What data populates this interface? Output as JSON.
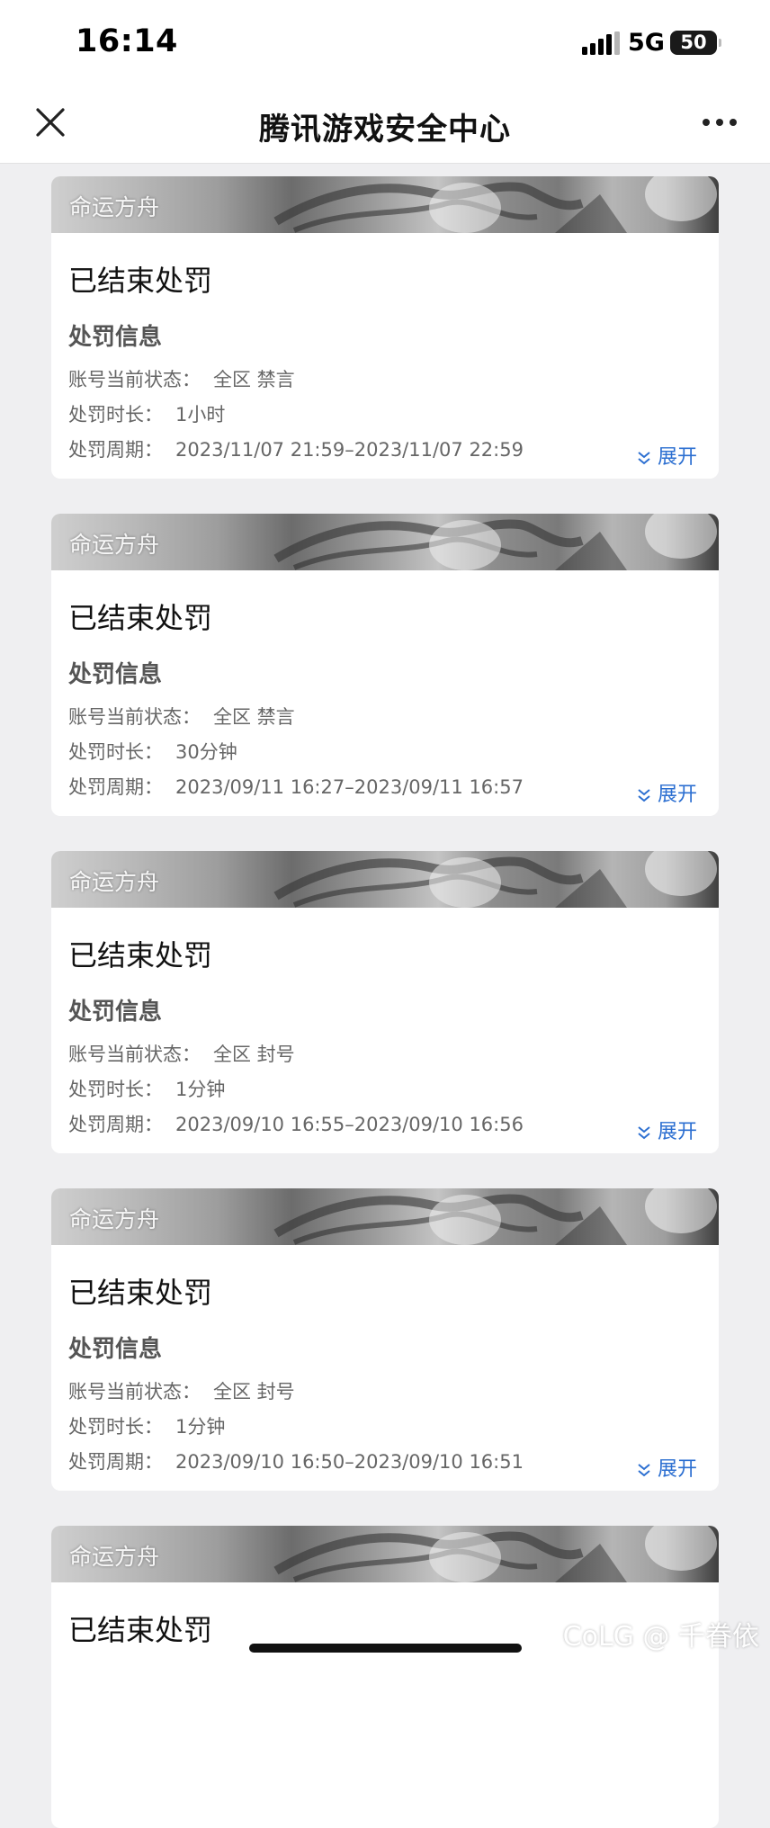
{
  "status_bar": {
    "time": "16:14",
    "network": "5G",
    "battery": "50",
    "signal_icon": "signal-bars-icon",
    "battery_icon": "battery-icon"
  },
  "nav": {
    "title": "腾讯游戏安全中心",
    "close_icon": "close-icon",
    "more_icon": "more-dots-icon"
  },
  "labels": {
    "section_title": "处罚信息",
    "account_status": "账号当前状态：",
    "duration": "处罚时长：",
    "period": "处罚周期：",
    "expand": "展开"
  },
  "cards": [
    {
      "game": "命运方舟",
      "status": "已结束处罚",
      "account_status": "全区 禁言",
      "duration": "1小时",
      "period": "2023/11/07 21:59–2023/11/07 22:59"
    },
    {
      "game": "命运方舟",
      "status": "已结束处罚",
      "account_status": "全区 禁言",
      "duration": "30分钟",
      "period": "2023/09/11 16:27–2023/09/11 16:57"
    },
    {
      "game": "命运方舟",
      "status": "已结束处罚",
      "account_status": "全区 封号",
      "duration": "1分钟",
      "period": "2023/09/10 16:55–2023/09/10 16:56"
    },
    {
      "game": "命运方舟",
      "status": "已结束处罚",
      "account_status": "全区 封号",
      "duration": "1分钟",
      "period": "2023/09/10 16:50–2023/09/10 16:51"
    },
    {
      "game": "命运方舟",
      "status": "已结束处罚"
    }
  ],
  "watermark": "CoLG @ 千眷依",
  "colors": {
    "background": "#efeff1",
    "card": "#ffffff",
    "link": "#2c6fd1"
  }
}
